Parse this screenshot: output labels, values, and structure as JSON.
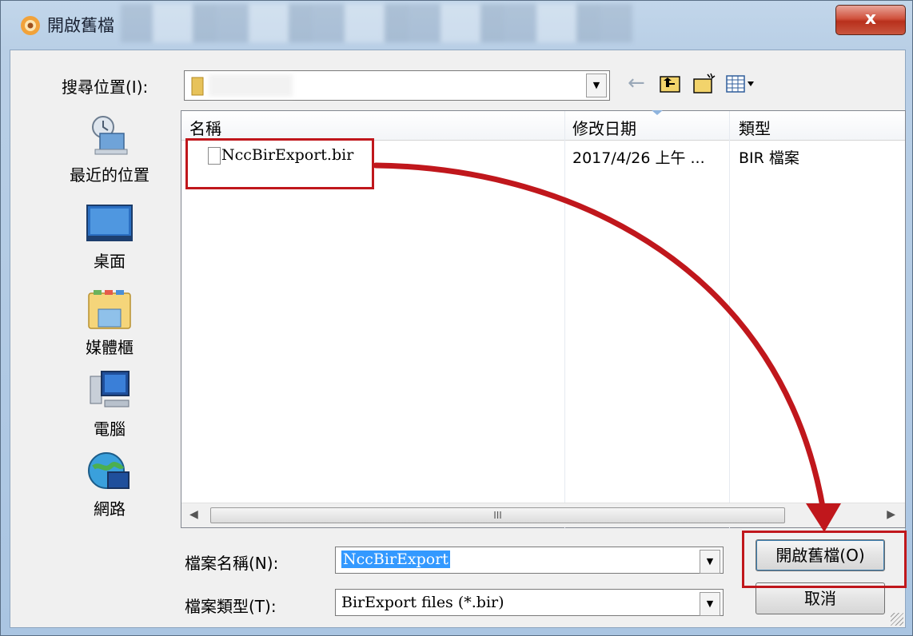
{
  "window": {
    "title": "開啟舊檔",
    "close_glyph": "x"
  },
  "toolbar": {
    "lookin_label": "搜尋位置(I):",
    "back_glyph": "←"
  },
  "places": [
    {
      "label": "最近的位置",
      "icon": "recent-places-icon"
    },
    {
      "label": "桌面",
      "icon": "desktop-icon"
    },
    {
      "label": "媒體櫃",
      "icon": "libraries-icon"
    },
    {
      "label": "電腦",
      "icon": "computer-icon"
    },
    {
      "label": "網路",
      "icon": "network-icon"
    }
  ],
  "list": {
    "columns": [
      "名稱",
      "修改日期",
      "類型"
    ],
    "rows": [
      {
        "name": "NccBirExport.bir",
        "modified": "2017/4/26 上午 ...",
        "type": "BIR 檔案"
      }
    ],
    "scroll_thumb_glyph": "III"
  },
  "form": {
    "filename_label": "檔案名稱(N):",
    "filename_value": "NccBirExport",
    "filetype_label": "檔案類型(T):",
    "filetype_value": "BirExport files (*.bir)",
    "open_label": "開啟舊檔(O)",
    "cancel_label": "取消"
  },
  "colors": {
    "annotation": "#c0171c",
    "selection": "#3399ff",
    "close_button": "#c9553f"
  }
}
